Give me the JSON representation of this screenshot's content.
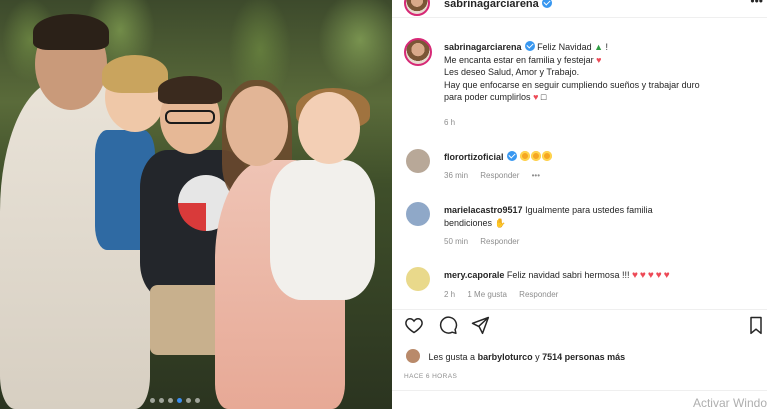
{
  "post": {
    "username": "sabrinagarciarena",
    "more_icon": "more-icon",
    "carousel": {
      "count": 6,
      "active_index": 3
    }
  },
  "caption": {
    "username": "sabrinagarciarena",
    "line1": "Feliz Navidad",
    "line1_suffix": "!",
    "line2": "Me encanta estar en familia y festejar",
    "line3": "Les deseo Salud, Amor y Trabajo.",
    "line4": "Hay que enfocarse en seguir cumpliendo sueños y trabajar duro",
    "line5": "para poder cumplirlos",
    "line5_suffix": "□",
    "time": "6 h"
  },
  "comments": [
    {
      "username": "florortizoficial",
      "text": "",
      "time": "36 min",
      "reply": "Responder",
      "more": "•••",
      "avatar_color": "#b8a898"
    },
    {
      "username": "marielacastro9517",
      "text": "Igualmente para ustedes familia",
      "text2": "bendiciones",
      "time": "50 min",
      "reply": "Responder",
      "avatar_color": "#8fa8c8"
    },
    {
      "username": "mery.caporale",
      "text": "Feliz navidad sabri hermosa !!!",
      "time": "2 h",
      "likes": "1 Me gusta",
      "reply": "Responder",
      "avatar_color": "#e9d98b"
    }
  ],
  "likes": {
    "prefix": "Les gusta a",
    "user": "barbyloturco",
    "connector": "y",
    "count": "7514 personas más"
  },
  "time_ago": "HACE 6 HORAS",
  "watermark": "Activar Windo",
  "colors": {
    "accent": "#3897f0",
    "heart": "#ed4956",
    "text": "#262626",
    "muted": "#8e8e8e"
  }
}
